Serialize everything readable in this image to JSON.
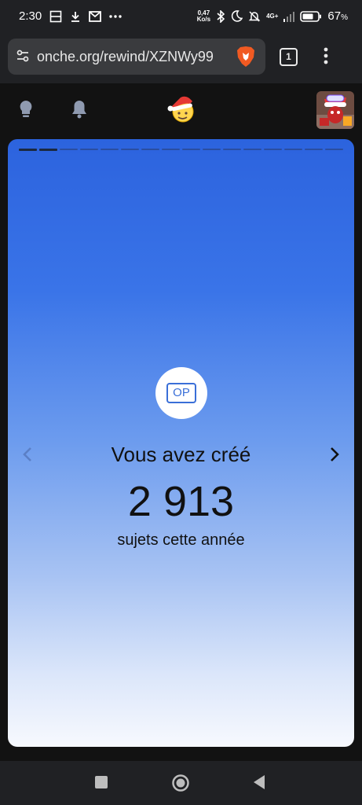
{
  "status_bar": {
    "time": "2:30",
    "net_speed_value": "0,47",
    "net_speed_unit": "Ko/s",
    "network_type": "4G+",
    "battery": "67",
    "battery_unit": "%"
  },
  "browser": {
    "url": "onche.org/rewind/XZNWy99",
    "tab_count": "1"
  },
  "card": {
    "icon_label": "OP",
    "headline": "Vous avez créé",
    "number": "2 913",
    "subtitle": "sujets cette année",
    "progress": {
      "total_segments": 16,
      "active_segments": 2
    }
  },
  "colors": {
    "card_top": "#2c63de",
    "card_bottom": "#f7f9fe",
    "accent": "#3a6fd8",
    "chrome_bg": "#202124"
  }
}
